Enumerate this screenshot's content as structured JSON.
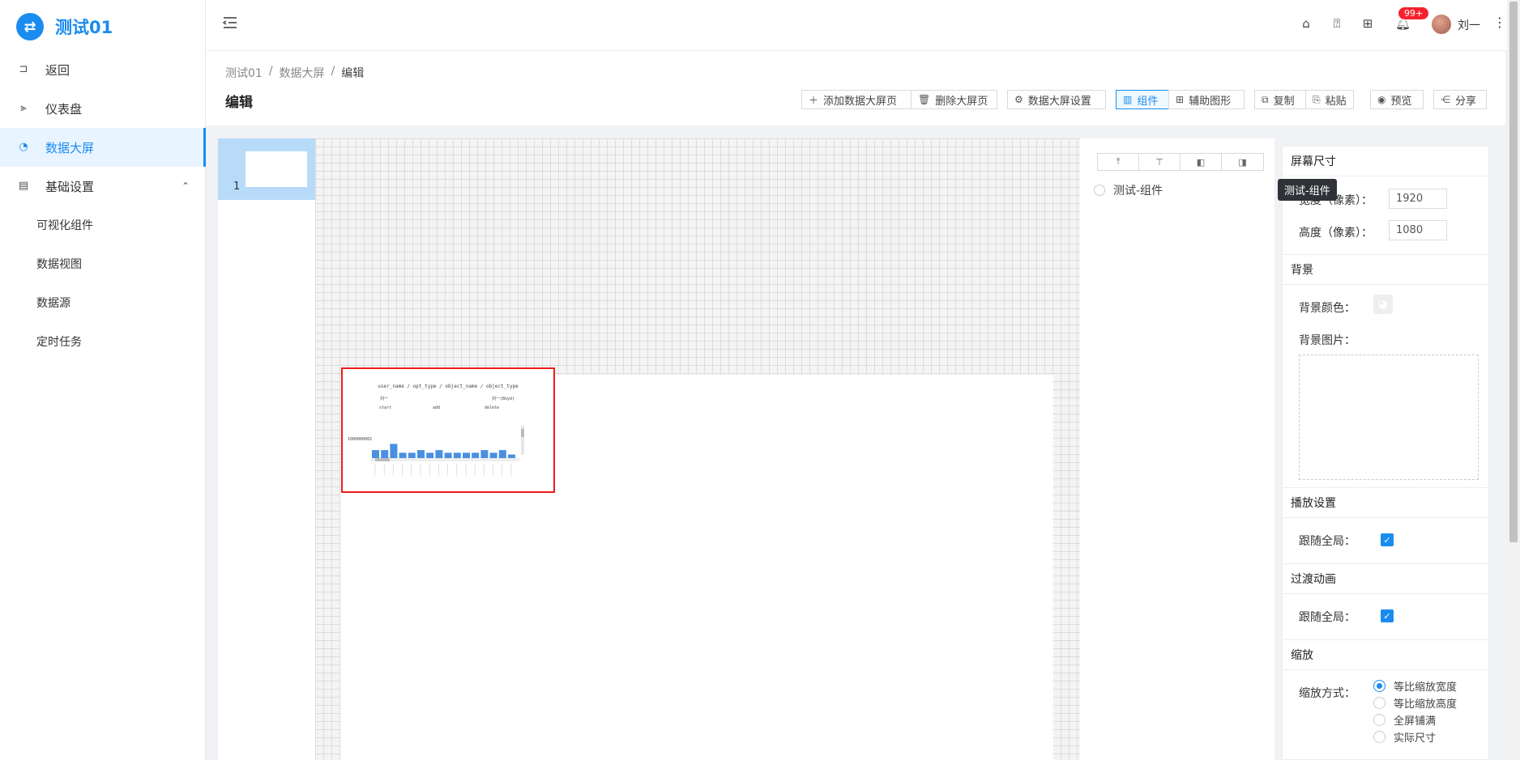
{
  "app": {
    "title": "测试01",
    "logo_glyph": "⇄"
  },
  "sidebar": {
    "items": [
      {
        "label": "返回",
        "icon": "back-icon"
      },
      {
        "label": "仪表盘",
        "icon": "dashboard-icon"
      },
      {
        "label": "数据大屏",
        "icon": "pie-chart-icon",
        "active": true
      },
      {
        "label": "基础设置",
        "icon": "table-icon",
        "expanded": true
      }
    ],
    "sub_items": [
      {
        "label": "可视化组件"
      },
      {
        "label": "数据视图"
      },
      {
        "label": "数据源"
      },
      {
        "label": "定时任务"
      }
    ]
  },
  "header": {
    "notification_count": "99+",
    "username": "刘一"
  },
  "breadcrumb": [
    "测试01",
    "数据大屏",
    "编辑"
  ],
  "breadcrumb_sep": "/",
  "page": {
    "title": "编辑"
  },
  "toolbar": {
    "add_page": "添加数据大屏页",
    "delete_page": "删除大屏页",
    "screen_settings": "数据大屏设置",
    "component": "组件",
    "aux_shape": "辅助图形",
    "copy": "复制",
    "paste": "粘贴",
    "preview": "预览",
    "share": "分享"
  },
  "pages": [
    {
      "number": "1"
    }
  ],
  "layers": {
    "items": [
      {
        "label": "测试-组件"
      }
    ],
    "tooltip": "测试-组件"
  },
  "settings": {
    "screen_size": {
      "title": "屏幕尺寸",
      "width_label": "宽度（像素）：",
      "width_value": "1920",
      "height_label": "高度（像素）：",
      "height_value": "1080"
    },
    "background": {
      "title": "背景",
      "color_label": "背景颜色：",
      "image_label": "背景图片："
    },
    "playback": {
      "title": "播放设置",
      "follow_label": "跟随全局：",
      "checked": true
    },
    "transition": {
      "title": "过渡动画",
      "follow_label": "跟随全局：",
      "checked": true
    },
    "zoom": {
      "title": "缩放",
      "mode_label": "缩放方式：",
      "options": [
        "等比缩放宽度",
        "等比缩放高度",
        "全屏铺满",
        "实际尺寸"
      ],
      "selected": 0
    }
  },
  "widget": {
    "title": "user_name / opt_type / object_name / object_type",
    "group_labels": [
      "刘一",
      "刘一(Boyd)"
    ],
    "sub_labels": [
      "start",
      "add",
      "delete"
    ],
    "y_label": "1000000002"
  },
  "chart_data": {
    "type": "bar",
    "values": [
      0.45,
      0.45,
      0.8,
      0.3,
      0.3,
      0.45,
      0.3,
      0.45,
      0.3,
      0.3,
      0.3,
      0.3,
      0.45,
      0.3,
      0.45,
      0.2
    ],
    "color": "#4a90e2"
  },
  "colors": {
    "accent": "#1a8cf0",
    "selection": "#f01a1a",
    "badge": "#f5222d"
  }
}
